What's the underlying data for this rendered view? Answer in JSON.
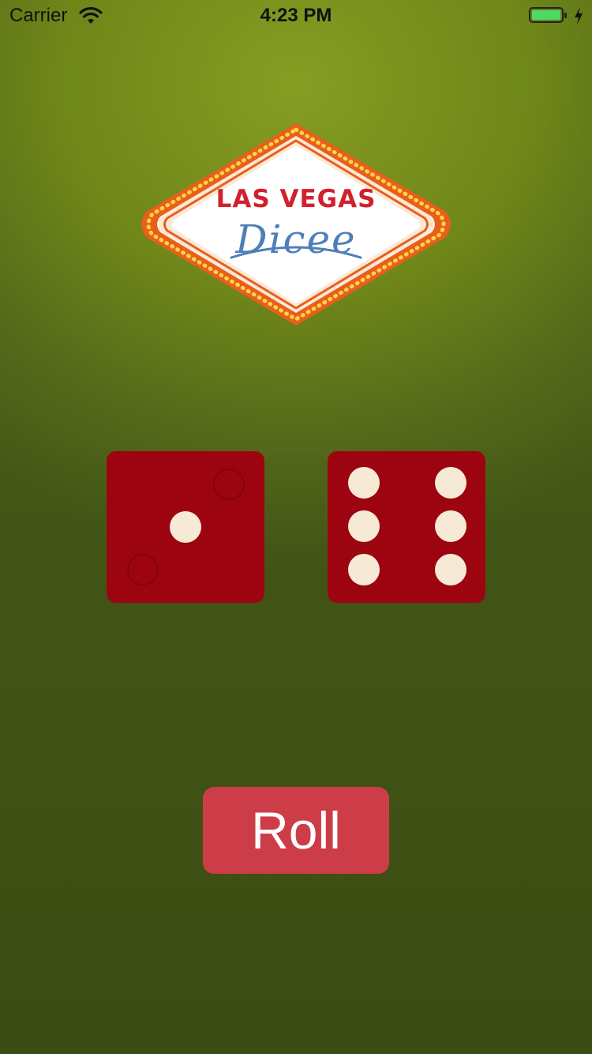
{
  "status_bar": {
    "carrier": "Carrier",
    "time": "4:23 PM",
    "battery_color": "#4cd964"
  },
  "logo": {
    "title": "LAS VEGAS",
    "subtitle": "Dicee"
  },
  "dice": {
    "left": {
      "value": 1,
      "icon": "dice-one-icon"
    },
    "right": {
      "value": 6,
      "icon": "dice-six-icon"
    },
    "face_color": "#9c0510",
    "pip_color": "#f6e9d5"
  },
  "roll_button": {
    "label": "Roll",
    "color": "#cc3d47"
  }
}
